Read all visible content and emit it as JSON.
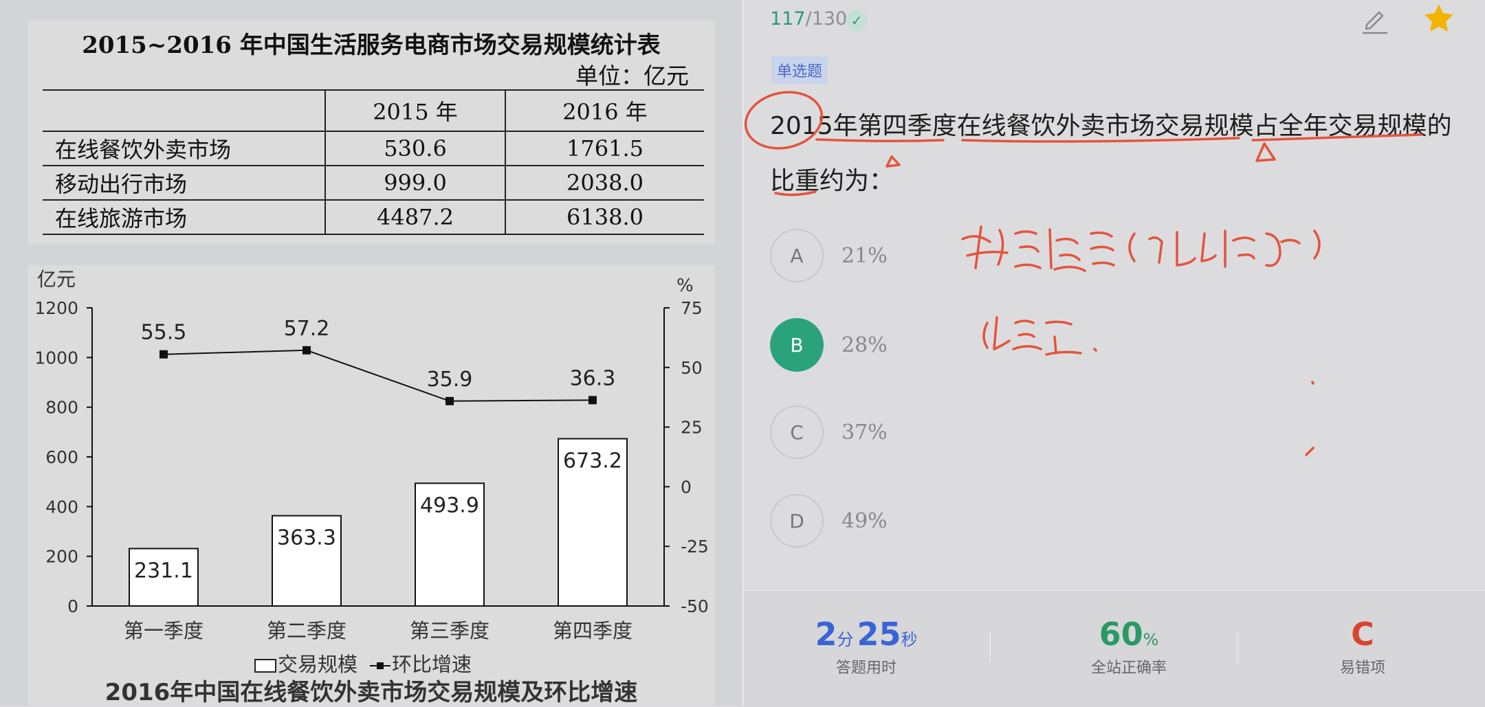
{
  "stat_table": {
    "title": "2015~2016 年中国生活服务电商市场交易规模统计表",
    "unit": "单位：亿元",
    "headers": [
      "",
      "2015 年",
      "2016 年"
    ],
    "rows": [
      [
        "在线餐饮外卖市场",
        "530.6",
        "1761.5"
      ],
      [
        "移动出行市场",
        "999.0",
        "2038.0"
      ],
      [
        "在线旅游市场",
        "4487.2",
        "6138.0"
      ]
    ]
  },
  "chart_data": {
    "type": "bar",
    "title": "2016年中国在线餐饮外卖市场交易规模及环比增速",
    "categories": [
      "第一季度",
      "第二季度",
      "第三季度",
      "第四季度"
    ],
    "ylabel": "亿元",
    "y2label": "%",
    "ylim": [
      0,
      1200
    ],
    "yticks": [
      "0",
      "200",
      "400",
      "600",
      "800",
      "1000",
      "1200"
    ],
    "y2lim": [
      -50,
      75
    ],
    "y2ticks": [
      "-50",
      "-25",
      "0",
      "25",
      "50",
      "75"
    ],
    "series": [
      {
        "name": "交易规模",
        "type": "bar",
        "axis": "left",
        "values": [
          231.1,
          363.3,
          493.9,
          673.2
        ],
        "labels": [
          "231.1",
          "363.3",
          "493.9",
          "673.2"
        ]
      },
      {
        "name": "环比增速",
        "type": "line",
        "axis": "right",
        "values": [
          55.5,
          57.2,
          35.9,
          36.3
        ],
        "labels": [
          "55.5",
          "57.2",
          "35.9",
          "36.3"
        ]
      }
    ],
    "legend": "bottom",
    "grid": false
  },
  "question_panel": {
    "progress_current": "117",
    "progress_total": "/130",
    "type_badge": "单选题",
    "question_text": "2015年第四季度在线餐饮外卖市场交易规模占全年交易规模的比重约为：",
    "options": [
      {
        "letter": "A",
        "text": "21%",
        "selected": false
      },
      {
        "letter": "B",
        "text": "28%",
        "selected": true
      },
      {
        "letter": "C",
        "text": "37%",
        "selected": false
      },
      {
        "letter": "D",
        "text": "49%",
        "selected": false
      }
    ],
    "accent_color": "#2aa37b",
    "annotation_color": "#e5533c"
  },
  "footer": {
    "time_min": "2",
    "time_min_unit": "分",
    "time_sec": "25",
    "time_sec_unit": "秒",
    "time_caption": "答题用时",
    "accuracy": "60",
    "accuracy_unit": "%",
    "accuracy_caption": "全站正确率",
    "common_wrong": "C",
    "common_wrong_caption": "易错项"
  }
}
